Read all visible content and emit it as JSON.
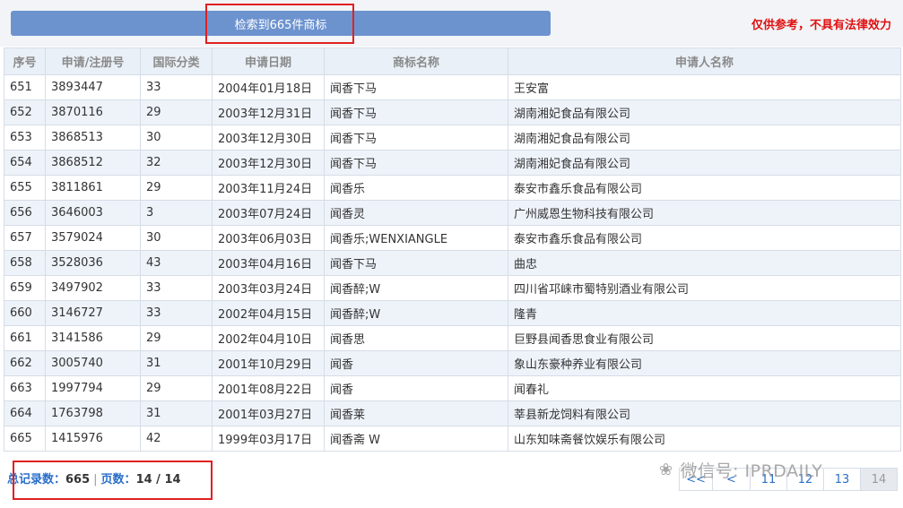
{
  "search": {
    "summary": "检索到665件商标"
  },
  "disclaimer": "仅供参考，不具有法律效力",
  "table": {
    "headers": [
      "序号",
      "申请/注册号",
      "国际分类",
      "申请日期",
      "商标名称",
      "申请人名称"
    ],
    "rows": [
      [
        "651",
        "3893447",
        "33",
        "2004年01月18日",
        "闻香下马",
        "王安富"
      ],
      [
        "652",
        "3870116",
        "29",
        "2003年12月31日",
        "闻香下马",
        "湖南湘妃食品有限公司"
      ],
      [
        "653",
        "3868513",
        "30",
        "2003年12月30日",
        "闻香下马",
        "湖南湘妃食品有限公司"
      ],
      [
        "654",
        "3868512",
        "32",
        "2003年12月30日",
        "闻香下马",
        "湖南湘妃食品有限公司"
      ],
      [
        "655",
        "3811861",
        "29",
        "2003年11月24日",
        "闻香乐",
        "泰安市鑫乐食品有限公司"
      ],
      [
        "656",
        "3646003",
        "3",
        "2003年07月24日",
        "闻香灵",
        "广州威恩生物科技有限公司"
      ],
      [
        "657",
        "3579024",
        "30",
        "2003年06月03日",
        "闻香乐;WENXIANGLE",
        "泰安市鑫乐食品有限公司"
      ],
      [
        "658",
        "3528036",
        "43",
        "2003年04月16日",
        "闻香下马",
        "曲忠"
      ],
      [
        "659",
        "3497902",
        "33",
        "2003年03月24日",
        "闻香醉;W",
        "四川省邛崃市蜀特别酒业有限公司"
      ],
      [
        "660",
        "3146727",
        "33",
        "2002年04月15日",
        "闻香醉;W",
        "隆青"
      ],
      [
        "661",
        "3141586",
        "29",
        "2002年04月10日",
        "闻香思",
        "巨野县闻香思食业有限公司"
      ],
      [
        "662",
        "3005740",
        "31",
        "2001年10月29日",
        "闻香",
        "象山东豪种养业有限公司"
      ],
      [
        "663",
        "1997794",
        "29",
        "2001年08月22日",
        "闻香",
        "闻春礼"
      ],
      [
        "664",
        "1763798",
        "31",
        "2001年03月27日",
        "闻香莱",
        "莘县新龙饲料有限公司"
      ],
      [
        "665",
        "1415976",
        "42",
        "1999年03月17日",
        "闻香斋 W",
        "山东知味斋餐饮娱乐有限公司"
      ]
    ]
  },
  "footer": {
    "total_label": "总记录数：",
    "total_value": "665",
    "separator": "|",
    "pages_label": "页数：",
    "pages_value": "14 / 14"
  },
  "pager": [
    "<<",
    "<",
    "11",
    "12",
    "13",
    "14"
  ],
  "watermark": {
    "icon": "wechat-icon",
    "text": "微信号: IPRDAILY"
  }
}
